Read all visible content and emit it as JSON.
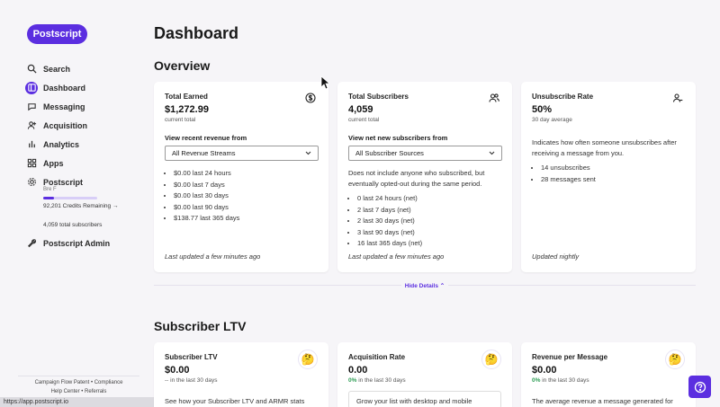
{
  "app": {
    "logo_text": "Postscript",
    "page_title": "Dashboard",
    "url": "https://app.postscript.io"
  },
  "nav": {
    "search": "Search",
    "dashboard": "Dashboard",
    "messaging": "Messaging",
    "acquisition": "Acquisition",
    "analytics": "Analytics",
    "apps": "Apps",
    "account": "Postscript",
    "account_user": "Bre F",
    "credits_remaining": "92,201 Credits Remaining →",
    "credits_fraction": 0.2,
    "total_subscribers": "4,059 total subscribers",
    "admin": "Postscript Admin"
  },
  "footer": {
    "link1": "Campaign Flow Patent",
    "link2": "Compliance",
    "link3": "Help Center",
    "link4": "Referrals"
  },
  "overview": {
    "title": "Overview",
    "earned": {
      "title": "Total Earned",
      "value": "$1,272.99",
      "sub": "current total",
      "label": "View recent revenue from",
      "select": "All Revenue Streams",
      "items": [
        "$0.00 last 24 hours",
        "$0.00 last 7 days",
        "$0.00 last 30 days",
        "$0.00 last 90 days",
        "$138.77 last 365 days"
      ],
      "updated": "Last updated a few minutes ago"
    },
    "subscribers": {
      "title": "Total Subscribers",
      "value": "4,059",
      "sub": "current total",
      "label": "View net new subscribers from",
      "select": "All Subscriber Sources",
      "note": "Does not include anyone who subscribed, but eventually opted-out during the same period.",
      "items": [
        "0 last 24 hours (net)",
        "2 last 7 days (net)",
        "2 last 30 days (net)",
        "3 last 90 days (net)",
        "16 last 365 days (net)"
      ],
      "updated": "Last updated a few minutes ago"
    },
    "unsubscribe": {
      "title": "Unsubscribe Rate",
      "value": "50%",
      "sub": "30 day average",
      "note": "Indicates how often someone unsubscribes after receiving a message from you.",
      "items": [
        "14 unsubscribes",
        "28 messages sent"
      ],
      "updated": "Updated nightly"
    },
    "hide_details": "Hide Details ⌃"
  },
  "ltv": {
    "title": "Subscriber LTV",
    "card1": {
      "title": "Subscriber LTV",
      "value": "$0.00",
      "change": "--",
      "sub": " in the last 30 days",
      "note": "See how your Subscriber LTV and ARMR stats have"
    },
    "card2": {
      "title": "Acquisition Rate",
      "value": "0.00",
      "change": "0%",
      "sub": " in the last 30 days",
      "note": "Grow your list with desktop and mobile popups."
    },
    "card3": {
      "title": "Revenue per Message",
      "value": "$0.00",
      "change": "0%",
      "sub": " in the last 30 days",
      "note": "The average revenue a message generated for you."
    }
  },
  "colors": {
    "brand": "#5b2ee0",
    "positive": "#2e9d55"
  }
}
